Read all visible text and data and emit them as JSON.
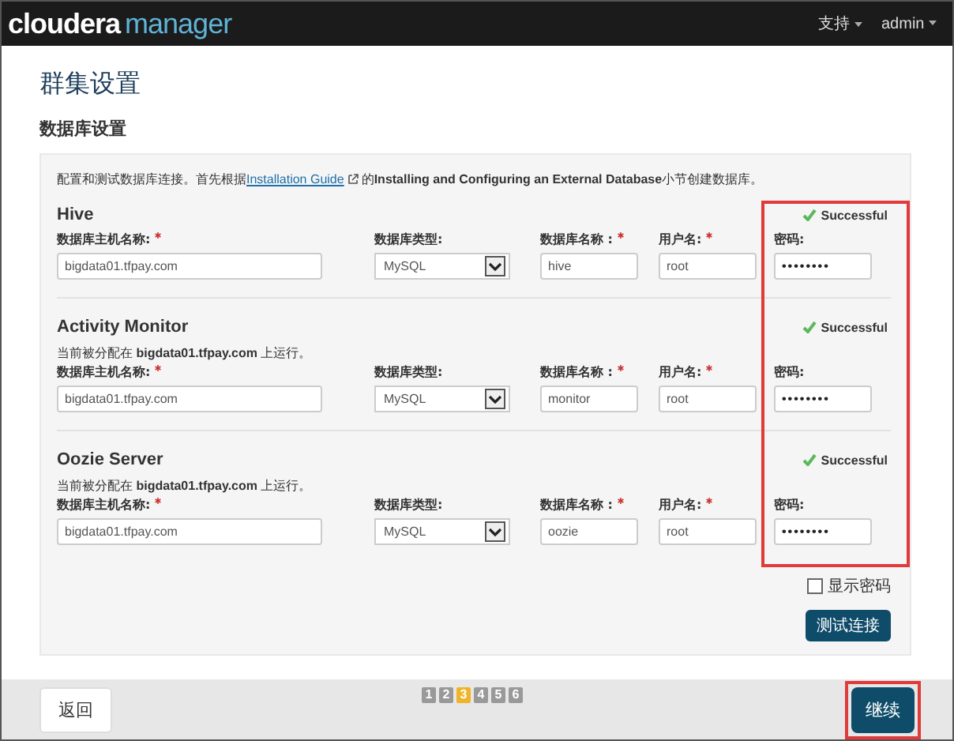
{
  "header": {
    "logo_brand": "cloudera",
    "logo_product": "manager",
    "menus": [
      "支持",
      "admin"
    ]
  },
  "title": "群集设置",
  "section_title": "数据库设置",
  "intro_before": "配置和测试数据库连接。首先根据",
  "intro_link": "Installation Guide",
  "intro_after": "的**Installing and Configuring an External Database**小节创建数据库。",
  "databases": [
    {
      "name": "Hive",
      "status": "Successful",
      "labels": {
        "host": "数据库主机名称:",
        "type": "数据库类型:",
        "db_name": "数据库名称 :",
        "user": "用户名:",
        "password": "密码:"
      },
      "host": "bigdata01.tfpay.com",
      "type": "MySQL",
      "db_name": "hive",
      "user": "root",
      "password": "••••••••"
    },
    {
      "name": "Activity Monitor",
      "status": "Successful",
      "note": "当前被分配在 **bigdata01.tfpay.com** 上运行。",
      "labels": {
        "host": "数据库主机名称:",
        "type": "数据库类型:",
        "db_name": "数据库名称 :",
        "user": "用户名:",
        "password": "密码:"
      },
      "host": "bigdata01.tfpay.com",
      "type": "MySQL",
      "db_name": "monitor",
      "user": "root",
      "password": "••••••••"
    },
    {
      "name": "Oozie Server",
      "status": "Successful",
      "note": "当前被分配在 **bigdata01.tfpay.com** 上运行。",
      "labels": {
        "host": "数据库主机名称:",
        "type": "数据库类型:",
        "db_name": "数据库名称 :",
        "user": "用户名:",
        "password": "密码:"
      },
      "host": "bigdata01.tfpay.com",
      "type": "MySQL",
      "db_name": "oozie",
      "user": "root",
      "password": "••••••••"
    }
  ],
  "show_password": {
    "label": "显示密码",
    "checked": false
  },
  "test_button": "测试连接",
  "footer": {
    "back": "返回",
    "continue": "继续",
    "steps": [
      {
        "label": "1",
        "selected": false
      },
      {
        "label": "2",
        "selected": false
      },
      {
        "label": "3",
        "selected": true
      },
      {
        "label": "4",
        "selected": false
      },
      {
        "label": "5",
        "selected": false
      },
      {
        "label": "6",
        "selected": false
      }
    ]
  }
}
